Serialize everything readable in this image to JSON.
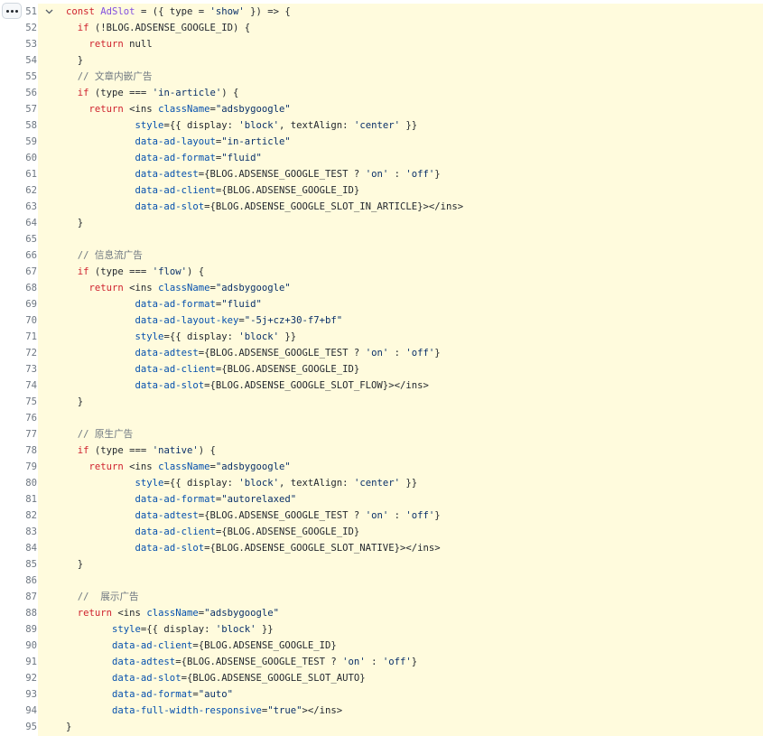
{
  "toolbar": {
    "more_icon": "kebab-horizontal-icon",
    "fold_icon": "chevron-down-icon"
  },
  "colors": {
    "background": "#fffbdd",
    "keyword": "#cf222e",
    "function": "#8250df",
    "string": "#0a3069",
    "attribute": "#0550ae",
    "comment": "#6e7781",
    "plain": "#24292f",
    "line_number": "#6e7781"
  },
  "lines": [
    {
      "n": "51",
      "fold": true,
      "tokens": [
        [
          "kw",
          "const "
        ],
        [
          "fn",
          "AdSlot"
        ],
        [
          "pl",
          " = ({ type = "
        ],
        [
          "str",
          "'show'"
        ],
        [
          "pl",
          " }) => {"
        ]
      ]
    },
    {
      "n": "52",
      "tokens": [
        [
          "pl",
          "  "
        ],
        [
          "kw",
          "if"
        ],
        [
          "pl",
          " (!BLOG.ADSENSE_GOOGLE_ID) {"
        ]
      ]
    },
    {
      "n": "53",
      "tokens": [
        [
          "pl",
          "    "
        ],
        [
          "kw",
          "return"
        ],
        [
          "pl",
          " null"
        ]
      ]
    },
    {
      "n": "54",
      "tokens": [
        [
          "pl",
          "  }"
        ]
      ]
    },
    {
      "n": "55",
      "tokens": [
        [
          "cm",
          "  // 文章内嵌广告"
        ]
      ]
    },
    {
      "n": "56",
      "tokens": [
        [
          "pl",
          "  "
        ],
        [
          "kw",
          "if"
        ],
        [
          "pl",
          " (type === "
        ],
        [
          "str",
          "'in-article'"
        ],
        [
          "pl",
          ") {"
        ]
      ]
    },
    {
      "n": "57",
      "tokens": [
        [
          "pl",
          "    "
        ],
        [
          "kw",
          "return"
        ],
        [
          "pl",
          " <ins "
        ],
        [
          "attr",
          "className"
        ],
        [
          "pl",
          "="
        ],
        [
          "str",
          "\"adsbygoogle\""
        ]
      ]
    },
    {
      "n": "58",
      "tokens": [
        [
          "pl",
          "            "
        ],
        [
          "attr",
          "style"
        ],
        [
          "pl",
          "={{ display: "
        ],
        [
          "str",
          "'block'"
        ],
        [
          "pl",
          ", textAlign: "
        ],
        [
          "str",
          "'center'"
        ],
        [
          "pl",
          " }}"
        ]
      ]
    },
    {
      "n": "59",
      "tokens": [
        [
          "pl",
          "            "
        ],
        [
          "attr",
          "data-ad-layout"
        ],
        [
          "pl",
          "="
        ],
        [
          "str",
          "\"in-article\""
        ]
      ]
    },
    {
      "n": "60",
      "tokens": [
        [
          "pl",
          "            "
        ],
        [
          "attr",
          "data-ad-format"
        ],
        [
          "pl",
          "="
        ],
        [
          "str",
          "\"fluid\""
        ]
      ]
    },
    {
      "n": "61",
      "tokens": [
        [
          "pl",
          "            "
        ],
        [
          "attr",
          "data-adtest"
        ],
        [
          "pl",
          "={BLOG.ADSENSE_GOOGLE_TEST ? "
        ],
        [
          "str",
          "'on'"
        ],
        [
          "pl",
          " : "
        ],
        [
          "str",
          "'off'"
        ],
        [
          "pl",
          "}"
        ]
      ]
    },
    {
      "n": "62",
      "tokens": [
        [
          "pl",
          "            "
        ],
        [
          "attr",
          "data-ad-client"
        ],
        [
          "pl",
          "={BLOG.ADSENSE_GOOGLE_ID}"
        ]
      ]
    },
    {
      "n": "63",
      "tokens": [
        [
          "pl",
          "            "
        ],
        [
          "attr",
          "data-ad-slot"
        ],
        [
          "pl",
          "={BLOG.ADSENSE_GOOGLE_SLOT_IN_ARTICLE}></ins>"
        ]
      ]
    },
    {
      "n": "64",
      "tokens": [
        [
          "pl",
          "  }"
        ]
      ]
    },
    {
      "n": "65",
      "tokens": []
    },
    {
      "n": "66",
      "tokens": [
        [
          "cm",
          "  // 信息流广告"
        ]
      ]
    },
    {
      "n": "67",
      "tokens": [
        [
          "pl",
          "  "
        ],
        [
          "kw",
          "if"
        ],
        [
          "pl",
          " (type === "
        ],
        [
          "str",
          "'flow'"
        ],
        [
          "pl",
          ") {"
        ]
      ]
    },
    {
      "n": "68",
      "tokens": [
        [
          "pl",
          "    "
        ],
        [
          "kw",
          "return"
        ],
        [
          "pl",
          " <ins "
        ],
        [
          "attr",
          "className"
        ],
        [
          "pl",
          "="
        ],
        [
          "str",
          "\"adsbygoogle\""
        ]
      ]
    },
    {
      "n": "69",
      "tokens": [
        [
          "pl",
          "            "
        ],
        [
          "attr",
          "data-ad-format"
        ],
        [
          "pl",
          "="
        ],
        [
          "str",
          "\"fluid\""
        ]
      ]
    },
    {
      "n": "70",
      "tokens": [
        [
          "pl",
          "            "
        ],
        [
          "attr",
          "data-ad-layout-key"
        ],
        [
          "pl",
          "="
        ],
        [
          "str",
          "\"-5j+cz+30-f7+bf\""
        ]
      ]
    },
    {
      "n": "71",
      "tokens": [
        [
          "pl",
          "            "
        ],
        [
          "attr",
          "style"
        ],
        [
          "pl",
          "={{ display: "
        ],
        [
          "str",
          "'block'"
        ],
        [
          "pl",
          " }}"
        ]
      ]
    },
    {
      "n": "72",
      "tokens": [
        [
          "pl",
          "            "
        ],
        [
          "attr",
          "data-adtest"
        ],
        [
          "pl",
          "={BLOG.ADSENSE_GOOGLE_TEST ? "
        ],
        [
          "str",
          "'on'"
        ],
        [
          "pl",
          " : "
        ],
        [
          "str",
          "'off'"
        ],
        [
          "pl",
          "}"
        ]
      ]
    },
    {
      "n": "73",
      "tokens": [
        [
          "pl",
          "            "
        ],
        [
          "attr",
          "data-ad-client"
        ],
        [
          "pl",
          "={BLOG.ADSENSE_GOOGLE_ID}"
        ]
      ]
    },
    {
      "n": "74",
      "tokens": [
        [
          "pl",
          "            "
        ],
        [
          "attr",
          "data-ad-slot"
        ],
        [
          "pl",
          "={BLOG.ADSENSE_GOOGLE_SLOT_FLOW}></ins>"
        ]
      ]
    },
    {
      "n": "75",
      "tokens": [
        [
          "pl",
          "  }"
        ]
      ]
    },
    {
      "n": "76",
      "tokens": []
    },
    {
      "n": "77",
      "tokens": [
        [
          "cm",
          "  // 原生广告"
        ]
      ]
    },
    {
      "n": "78",
      "tokens": [
        [
          "pl",
          "  "
        ],
        [
          "kw",
          "if"
        ],
        [
          "pl",
          " (type === "
        ],
        [
          "str",
          "'native'"
        ],
        [
          "pl",
          ") {"
        ]
      ]
    },
    {
      "n": "79",
      "tokens": [
        [
          "pl",
          "    "
        ],
        [
          "kw",
          "return"
        ],
        [
          "pl",
          " <ins "
        ],
        [
          "attr",
          "className"
        ],
        [
          "pl",
          "="
        ],
        [
          "str",
          "\"adsbygoogle\""
        ]
      ]
    },
    {
      "n": "80",
      "tokens": [
        [
          "pl",
          "            "
        ],
        [
          "attr",
          "style"
        ],
        [
          "pl",
          "={{ display: "
        ],
        [
          "str",
          "'block'"
        ],
        [
          "pl",
          ", textAlign: "
        ],
        [
          "str",
          "'center'"
        ],
        [
          "pl",
          " }}"
        ]
      ]
    },
    {
      "n": "81",
      "tokens": [
        [
          "pl",
          "            "
        ],
        [
          "attr",
          "data-ad-format"
        ],
        [
          "pl",
          "="
        ],
        [
          "str",
          "\"autorelaxed\""
        ]
      ]
    },
    {
      "n": "82",
      "tokens": [
        [
          "pl",
          "            "
        ],
        [
          "attr",
          "data-adtest"
        ],
        [
          "pl",
          "={BLOG.ADSENSE_GOOGLE_TEST ? "
        ],
        [
          "str",
          "'on'"
        ],
        [
          "pl",
          " : "
        ],
        [
          "str",
          "'off'"
        ],
        [
          "pl",
          "}"
        ]
      ]
    },
    {
      "n": "83",
      "tokens": [
        [
          "pl",
          "            "
        ],
        [
          "attr",
          "data-ad-client"
        ],
        [
          "pl",
          "={BLOG.ADSENSE_GOOGLE_ID}"
        ]
      ]
    },
    {
      "n": "84",
      "tokens": [
        [
          "pl",
          "            "
        ],
        [
          "attr",
          "data-ad-slot"
        ],
        [
          "pl",
          "={BLOG.ADSENSE_GOOGLE_SLOT_NATIVE}></ins>"
        ]
      ]
    },
    {
      "n": "85",
      "tokens": [
        [
          "pl",
          "  }"
        ]
      ]
    },
    {
      "n": "86",
      "tokens": []
    },
    {
      "n": "87",
      "tokens": [
        [
          "cm",
          "  //  展示广告"
        ]
      ]
    },
    {
      "n": "88",
      "tokens": [
        [
          "pl",
          "  "
        ],
        [
          "kw",
          "return"
        ],
        [
          "pl",
          " <ins "
        ],
        [
          "attr",
          "className"
        ],
        [
          "pl",
          "="
        ],
        [
          "str",
          "\"adsbygoogle\""
        ]
      ]
    },
    {
      "n": "89",
      "tokens": [
        [
          "pl",
          "        "
        ],
        [
          "attr",
          "style"
        ],
        [
          "pl",
          "={{ display: "
        ],
        [
          "str",
          "'block'"
        ],
        [
          "pl",
          " }}"
        ]
      ]
    },
    {
      "n": "90",
      "tokens": [
        [
          "pl",
          "        "
        ],
        [
          "attr",
          "data-ad-client"
        ],
        [
          "pl",
          "={BLOG.ADSENSE_GOOGLE_ID}"
        ]
      ]
    },
    {
      "n": "91",
      "tokens": [
        [
          "pl",
          "        "
        ],
        [
          "attr",
          "data-adtest"
        ],
        [
          "pl",
          "={BLOG.ADSENSE_GOOGLE_TEST ? "
        ],
        [
          "str",
          "'on'"
        ],
        [
          "pl",
          " : "
        ],
        [
          "str",
          "'off'"
        ],
        [
          "pl",
          "}"
        ]
      ]
    },
    {
      "n": "92",
      "tokens": [
        [
          "pl",
          "        "
        ],
        [
          "attr",
          "data-ad-slot"
        ],
        [
          "pl",
          "={BLOG.ADSENSE_GOOGLE_SLOT_AUTO}"
        ]
      ]
    },
    {
      "n": "93",
      "tokens": [
        [
          "pl",
          "        "
        ],
        [
          "attr",
          "data-ad-format"
        ],
        [
          "pl",
          "="
        ],
        [
          "str",
          "\"auto\""
        ]
      ]
    },
    {
      "n": "94",
      "tokens": [
        [
          "pl",
          "        "
        ],
        [
          "attr",
          "data-full-width-responsive"
        ],
        [
          "pl",
          "="
        ],
        [
          "str",
          "\"true\""
        ],
        [
          "pl",
          "></ins>"
        ]
      ]
    },
    {
      "n": "95",
      "tokens": [
        [
          "pl",
          "}"
        ]
      ]
    }
  ]
}
